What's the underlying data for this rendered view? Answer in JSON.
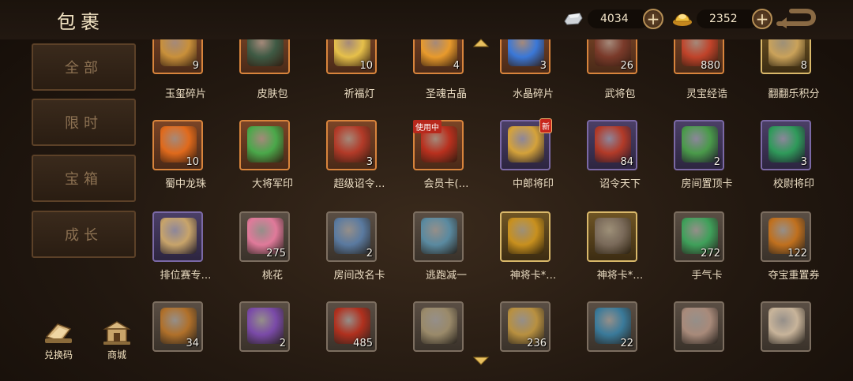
{
  "header": {
    "title": "包裹",
    "silver": {
      "amount": "4034",
      "icon": "silver-ingot-icon"
    },
    "gold": {
      "amount": "2352",
      "icon": "gold-ingot-icon"
    },
    "plus_label": "+"
  },
  "tabs": [
    {
      "label": "全部",
      "active": true
    },
    {
      "label": "限时",
      "active": false
    },
    {
      "label": "宝箱",
      "active": false
    },
    {
      "label": "成长",
      "active": false
    }
  ],
  "bottom_buttons": [
    {
      "label": "兑换码",
      "icon": "redeem-code-icon"
    },
    {
      "label": "商城",
      "icon": "shop-icon"
    }
  ],
  "items": [
    {
      "name": "玉玺碎片",
      "count": "9",
      "frame": "orange",
      "icon": "puzzle-piece-icon",
      "color": "#c9903a"
    },
    {
      "name": "皮肤包",
      "count": "",
      "frame": "orange",
      "icon": "skin-pack-icon",
      "color": "#3e5a44"
    },
    {
      "name": "祈福灯",
      "count": "10",
      "frame": "orange",
      "icon": "lantern-icon",
      "color": "#e6c04a"
    },
    {
      "name": "圣魂古晶",
      "count": "4",
      "frame": "orange",
      "icon": "crystal-orange-icon",
      "color": "#e89a2c"
    },
    {
      "name": "水晶碎片",
      "count": "3",
      "frame": "orange",
      "icon": "crystal-blue-icon",
      "color": "#3a78d8"
    },
    {
      "name": "武将包",
      "count": "26",
      "frame": "orange",
      "icon": "general-pack-icon",
      "color": "#7a3a2a"
    },
    {
      "name": "灵宝经诰",
      "count": "880",
      "frame": "orange",
      "icon": "treasure-scroll-icon",
      "color": "#c0432a"
    },
    {
      "name": "翻翻乐积分",
      "count": "8",
      "frame": "gold",
      "icon": "coin-medal-icon",
      "color": "#caa25a"
    },
    {
      "name": "蜀中龙珠",
      "count": "10",
      "frame": "orange",
      "icon": "dragon-orb-icon",
      "color": "#e06a1c"
    },
    {
      "name": "大将军印",
      "count": "",
      "frame": "orange",
      "icon": "jade-seal-icon",
      "color": "#4aa84a"
    },
    {
      "name": "超级诏令…",
      "count": "3",
      "frame": "orange",
      "icon": "decree-scroll-icon",
      "color": "#b23a28"
    },
    {
      "name": "会员卡(…",
      "count": "",
      "frame": "orange",
      "icon": "vip-card-icon",
      "color": "#b8301e",
      "badge_use": "使用中"
    },
    {
      "name": "中郎将印",
      "count": "",
      "frame": "purple",
      "icon": "golden-seal-icon",
      "color": "#d4a23a",
      "badge_new": "新"
    },
    {
      "name": "诏令天下",
      "count": "84",
      "frame": "purple",
      "icon": "decree-scroll-icon",
      "color": "#b23a28"
    },
    {
      "name": "房间置顶卡",
      "count": "2",
      "frame": "purple",
      "icon": "room-top-card-icon",
      "color": "#4a9a4a"
    },
    {
      "name": "校尉将印",
      "count": "3",
      "frame": "purple",
      "icon": "green-orb-icon",
      "color": "#2f9a5a"
    },
    {
      "name": "排位赛专…",
      "count": "",
      "frame": "purple",
      "icon": "rank-scroll-icon",
      "color": "#c8a46a"
    },
    {
      "name": "桃花",
      "count": "275",
      "frame": "gray",
      "icon": "peach-blossom-icon",
      "color": "#e07a9a"
    },
    {
      "name": "房间改名卡",
      "count": "2",
      "frame": "gray",
      "icon": "rename-card-icon",
      "color": "#5a7aa0"
    },
    {
      "name": "逃跑减一",
      "count": "",
      "frame": "gray",
      "icon": "escape-token-icon",
      "color": "#5a8aa0"
    },
    {
      "name": "神将卡*…",
      "count": "",
      "frame": "gold",
      "icon": "hero-portrait-icon",
      "color": "#c8901e"
    },
    {
      "name": "神将卡*…",
      "count": "",
      "frame": "gold",
      "icon": "hero-portrait-icon",
      "color": "#7a6a5a"
    },
    {
      "name": "手气卡",
      "count": "272",
      "frame": "gray",
      "icon": "jade-bracelet-icon",
      "color": "#3fa05a"
    },
    {
      "name": "夺宝重置券",
      "count": "122",
      "frame": "gray",
      "icon": "reset-ticket-icon",
      "color": "#c0701e"
    },
    {
      "name": "",
      "count": "34",
      "frame": "gray",
      "icon": "puzzle-piece-icon",
      "color": "#b0702a"
    },
    {
      "name": "",
      "count": "2",
      "frame": "gray",
      "icon": "purple-ticket-icon",
      "color": "#7a4aa8"
    },
    {
      "name": "",
      "count": "485",
      "frame": "gray",
      "icon": "decree-pouch-icon",
      "color": "#b0301e"
    },
    {
      "name": "",
      "count": "",
      "frame": "gray",
      "icon": "bamboo-scroll-icon",
      "color": "#9a8a6a"
    },
    {
      "name": "",
      "count": "236",
      "frame": "gray",
      "icon": "puzzle-piece-icon",
      "color": "#b89040"
    },
    {
      "name": "",
      "count": "22",
      "frame": "gray",
      "icon": "escape-token-icon",
      "color": "#3a7a9a"
    },
    {
      "name": "",
      "count": "",
      "frame": "gray",
      "icon": "blank-frame-icon",
      "color": "#a88a7a"
    },
    {
      "name": "",
      "count": "",
      "frame": "gray",
      "icon": "blank-frame-icon",
      "color": "#c8b49a"
    }
  ]
}
